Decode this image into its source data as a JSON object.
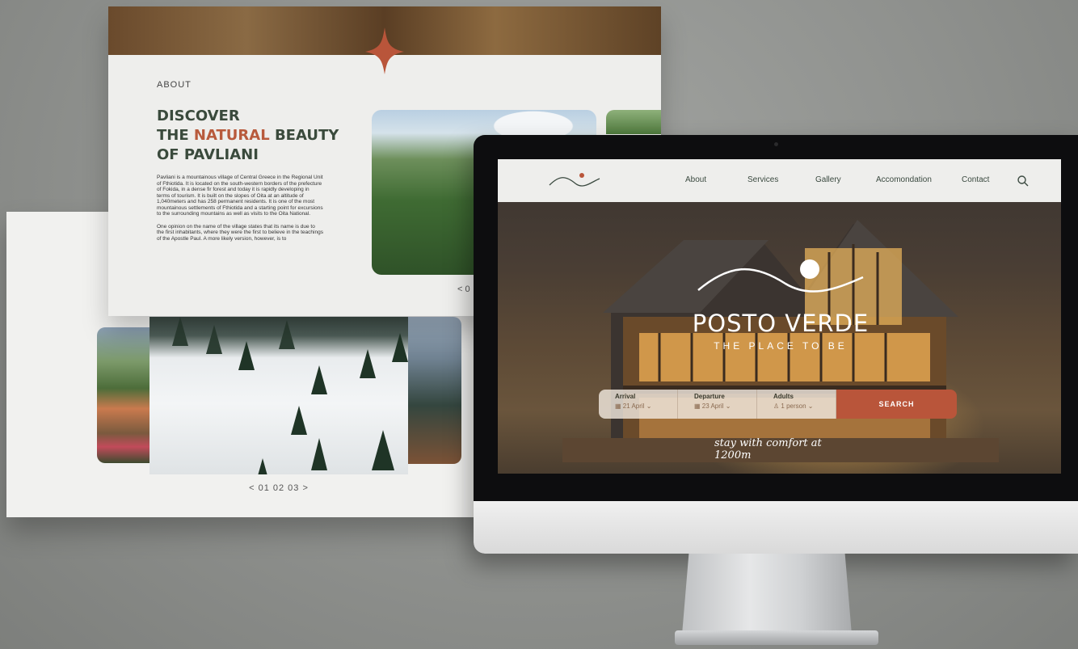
{
  "about_page": {
    "section_label": "ABOUT",
    "title": {
      "line1": "DISCOVER",
      "line2_pre": "THE ",
      "line2_highlight": "NATURAL",
      "line2_post": " BEAUTY",
      "line3": "OF PAVLIANI"
    },
    "paragraphs": [
      "Pavliani is a mountainous village of Central Greece in the Regional Unit of Fthiotida. It is located on the south-western borders of the prefecture of Fokida, in a dense fir forest and today it is rapidly developing in terms of tourism. It is built on the slopes of Oita at an altitude of 1,040meters and has 258 permanent residents. It is one of the most mountainous settlements of Fthiotida and a starting point for excursions to the surrounding mountains as well as visits to the Oita National.",
      "One opinion on the name of the village states that its name is due to the first inhabitants, where they were the first to believe in the teachings of the Apostle Paul. A more likely version, however, is to"
    ],
    "pager": "< 0"
  },
  "slider_page": {
    "pager": "< 01 02 03 >"
  },
  "site": {
    "nav": {
      "items": [
        "About",
        "Services",
        "Gallery",
        "Accomondation",
        "Contact"
      ]
    },
    "hero": {
      "title": "POSTO VERDE",
      "subtitle": "THE PLACE TO BE",
      "tagline": "stay with comfort at 1200m"
    },
    "booking": {
      "arrival_label": "Arrival",
      "arrival_value": "21 April",
      "departure_label": "Departure",
      "departure_value": "23 April",
      "adults_label": "Adults",
      "adults_value": "1 person",
      "search_label": "SEARCH"
    }
  },
  "colors": {
    "accent": "#b9553a",
    "dark_green": "#3a4a3c",
    "panel_bg": "#eeeeec"
  }
}
